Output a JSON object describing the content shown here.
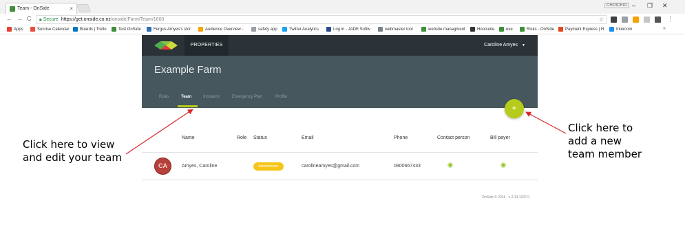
{
  "browser": {
    "tab_title": "Team - OnSide",
    "tab_close": "×",
    "profile": "CHOICEIO",
    "window_min": "–",
    "window_restore": "❐",
    "window_close": "✕",
    "secure_label": "Secure",
    "url_host": "https://get.onside.co.nz",
    "url_path": "/onside/Farm/Team/1600",
    "bookmarks": [
      {
        "label": "Apps",
        "color": "#e94235"
      },
      {
        "label": "Sunrise Calendar",
        "color": "#ea4d3d"
      },
      {
        "label": "Boards | Trello",
        "color": "#0079bf"
      },
      {
        "label": "Test OnSide",
        "color": "#3d8f3a"
      },
      {
        "label": "Fergus Amyes's stor",
        "color": "#2c6fb5"
      },
      {
        "label": "Audience Overview -",
        "color": "#f4a300"
      },
      {
        "label": "safety app",
        "color": "#9aa0a6"
      },
      {
        "label": "Twitter Analytics",
        "color": "#1da1f2"
      },
      {
        "label": "Log in - JADE Softw",
        "color": "#2d4b8a"
      },
      {
        "label": "webmaster tool",
        "color": "#7a8288"
      },
      {
        "label": "website managment",
        "color": "#3d8f3a"
      },
      {
        "label": "Hootsuite",
        "color": "#333333"
      },
      {
        "label": "eve",
        "color": "#3d8f3a"
      },
      {
        "label": "Risks - OnSide",
        "color": "#3d8f3a"
      },
      {
        "label": "Payment Express | H",
        "color": "#e8451d"
      },
      {
        "label": "Intercom",
        "color": "#1f8ded"
      }
    ],
    "bookmarks_more": "»"
  },
  "app": {
    "nav_tab": "PROPERTIES",
    "user_name": "Caroline Amyes",
    "user_caret": "▼",
    "farm_name": "Example Farm",
    "tabs": [
      "Risks",
      "Team",
      "Incidents",
      "Emergency Plan",
      "Profile"
    ],
    "active_tab": "Team",
    "fab_label": "+",
    "table": {
      "headers": [
        "Name",
        "Role",
        "Status",
        "Email",
        "Phone",
        "Contact person",
        "Bill payer"
      ],
      "rows": [
        {
          "initials": "CA",
          "name": "Amyes, Caroline",
          "role": "",
          "status": "Administrator",
          "email": "carolineamyes@gmail.com",
          "phone": "0800667433",
          "contact_person": true,
          "bill_payer": true
        }
      ]
    },
    "footer": "OnSide © 2016 · v 2.14.1237.0"
  },
  "annotations": {
    "left_note": [
      "Click here to view",
      "and edit your team"
    ],
    "right_note": [
      "Click here to",
      "add a new",
      "team member"
    ],
    "arrow_color": "#d9262b"
  },
  "colors": {
    "nav_bg": "#2c3338",
    "header_bg": "#47575e",
    "accent": "#b9cc1c",
    "status_badge": "#f5c518"
  }
}
